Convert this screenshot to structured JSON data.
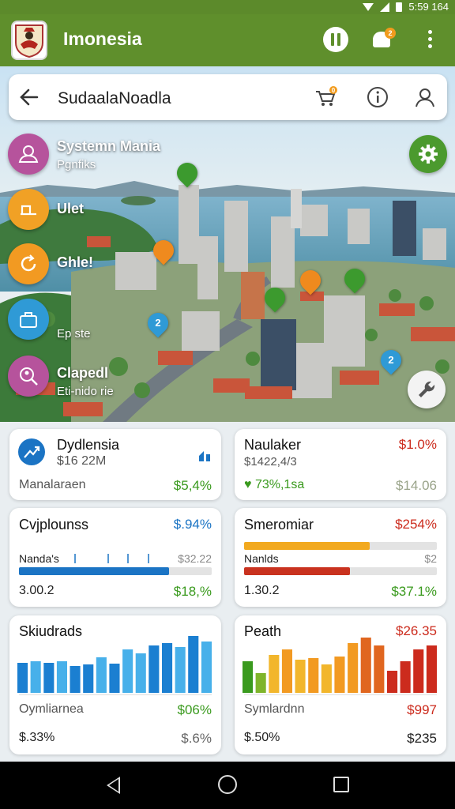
{
  "status": {
    "clock": "5:59 164"
  },
  "appbar": {
    "title": "Imonesia"
  },
  "search": {
    "query": "SudaalaNoadla",
    "cart_badge": "0"
  },
  "notifications": {
    "badge": "2"
  },
  "side_menu": [
    {
      "label": "Systemn Mania",
      "sub": "Pgnfiks",
      "color": "#b6539c",
      "icon": "user-icon"
    },
    {
      "label": "Ulet",
      "sub": "",
      "color": "#f1a125",
      "icon": "desk-icon"
    },
    {
      "label": "Ghle!",
      "sub": "",
      "color": "#f29a22",
      "icon": "refresh-icon"
    },
    {
      "label": "",
      "sub": "Ep ste",
      "color": "#2f9ad6",
      "icon": "briefcase-icon"
    },
    {
      "label": "Clapedl",
      "sub": "Eti-nido rie",
      "color": "#b6539c",
      "icon": "search-person-icon"
    }
  ],
  "map_pins": [
    {
      "label": "",
      "color": "#3c9a2e"
    },
    {
      "label": "",
      "color": "#ef8a1e"
    },
    {
      "label": "",
      "color": "#ef8a1e"
    },
    {
      "label": "",
      "color": "#3c9a2e"
    },
    {
      "label": "",
      "color": "#3c9a2e"
    },
    {
      "label": "2",
      "color": "#2f9ad6"
    },
    {
      "label": "2",
      "color": "#2f9ad6"
    }
  ],
  "cards": {
    "c1": {
      "title": "Dydlensia",
      "amount": "$16 22M",
      "label": "Manalaraen",
      "value": "$5,4%"
    },
    "c2": {
      "title": "Naulaker",
      "change": "$1.0%",
      "amount": "$1422,4/3",
      "trend": "♥ 73%,1sa",
      "value": "$14.06"
    },
    "c3": {
      "title": "Cvjplounss",
      "change": "$.94%",
      "bar_label": "Nanda's",
      "bar_value": "$32.22",
      "bar_pct": 0.78,
      "foot_left": "3.00.2",
      "foot_value": "$18,%"
    },
    "c4": {
      "title": "Smeromiar",
      "change": "$254%",
      "bar1_pct": 0.65,
      "bar_label": "Nanlds",
      "bar_value": "$2",
      "bar2_pct": 0.55,
      "foot_left": "1.30.2",
      "foot_value": "$37.1%"
    },
    "c5": {
      "title": "Skiudrads",
      "label": "Oymliarnea",
      "value": "$06%",
      "foot_left": "$.33%",
      "foot_value": "$.6%"
    },
    "c6": {
      "title": "Peath",
      "change": "$26.35",
      "label": "Symlardnn",
      "value": "$997",
      "foot_left": "$.50%",
      "foot_value": "$235"
    }
  },
  "chart_data": [
    {
      "type": "bar",
      "title": "Skiudrads",
      "values": [
        38,
        40,
        38,
        40,
        34,
        36,
        45,
        37,
        55,
        50,
        60,
        63,
        58,
        72,
        65
      ],
      "colors": [
        "#1b7fd1",
        "#47b0ea",
        "#1b7fd1",
        "#47b0ea",
        "#1b7fd1",
        "#1b7fd1",
        "#47b0ea",
        "#1b7fd1",
        "#47b0ea",
        "#47b0ea",
        "#1b7fd1",
        "#1b7fd1",
        "#47b0ea",
        "#1b7fd1",
        "#47b0ea"
      ],
      "ylim": [
        0,
        80
      ]
    },
    {
      "type": "bar",
      "title": "Peath",
      "values": [
        40,
        25,
        48,
        55,
        42,
        44,
        36,
        46,
        63,
        70,
        60,
        28,
        40,
        55,
        60
      ],
      "colors": [
        "#3a9a1e",
        "#7fb52b",
        "#f2b62c",
        "#f29a22",
        "#f2b62c",
        "#f29a22",
        "#f2b62c",
        "#f29a22",
        "#f29a22",
        "#e0661f",
        "#e0661f",
        "#cc2b1d",
        "#cc2b1d",
        "#cc2b1d",
        "#cc2b1d"
      ],
      "ylim": [
        0,
        80
      ]
    }
  ]
}
